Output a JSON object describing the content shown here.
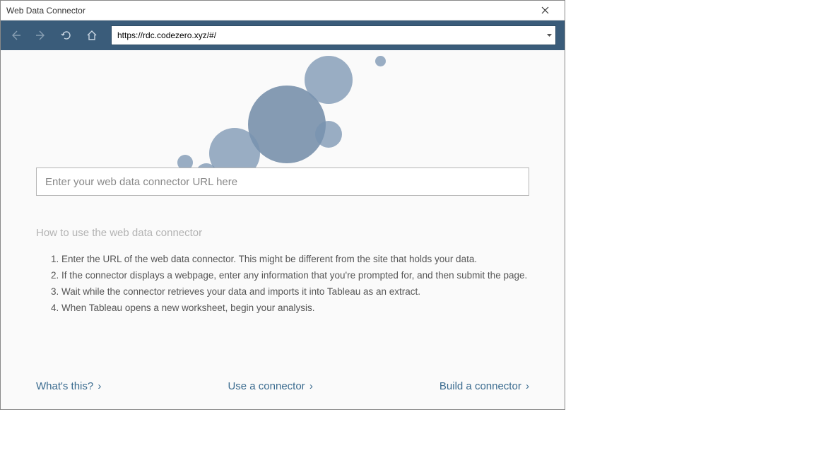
{
  "window": {
    "title": "Web Data Connector"
  },
  "nav": {
    "address": "https://rdc.codezero.xyz/#/"
  },
  "main": {
    "url_input_placeholder": "Enter your web data connector URL here",
    "howto_heading": "How to use the web data connector",
    "steps": [
      "Enter the URL of the web data connector. This might be different from the site that holds your data.",
      "If the connector displays a webpage, enter any information that you're prompted for, and then submit the page.",
      "Wait while the connector retrieves your data and imports it into Tableau as an extract.",
      "When Tableau opens a new worksheet, begin your analysis."
    ]
  },
  "links": {
    "whats_this": "What's this?",
    "use_connector": "Use a connector",
    "build_connector": "Build a connector",
    "chevron": "›"
  }
}
